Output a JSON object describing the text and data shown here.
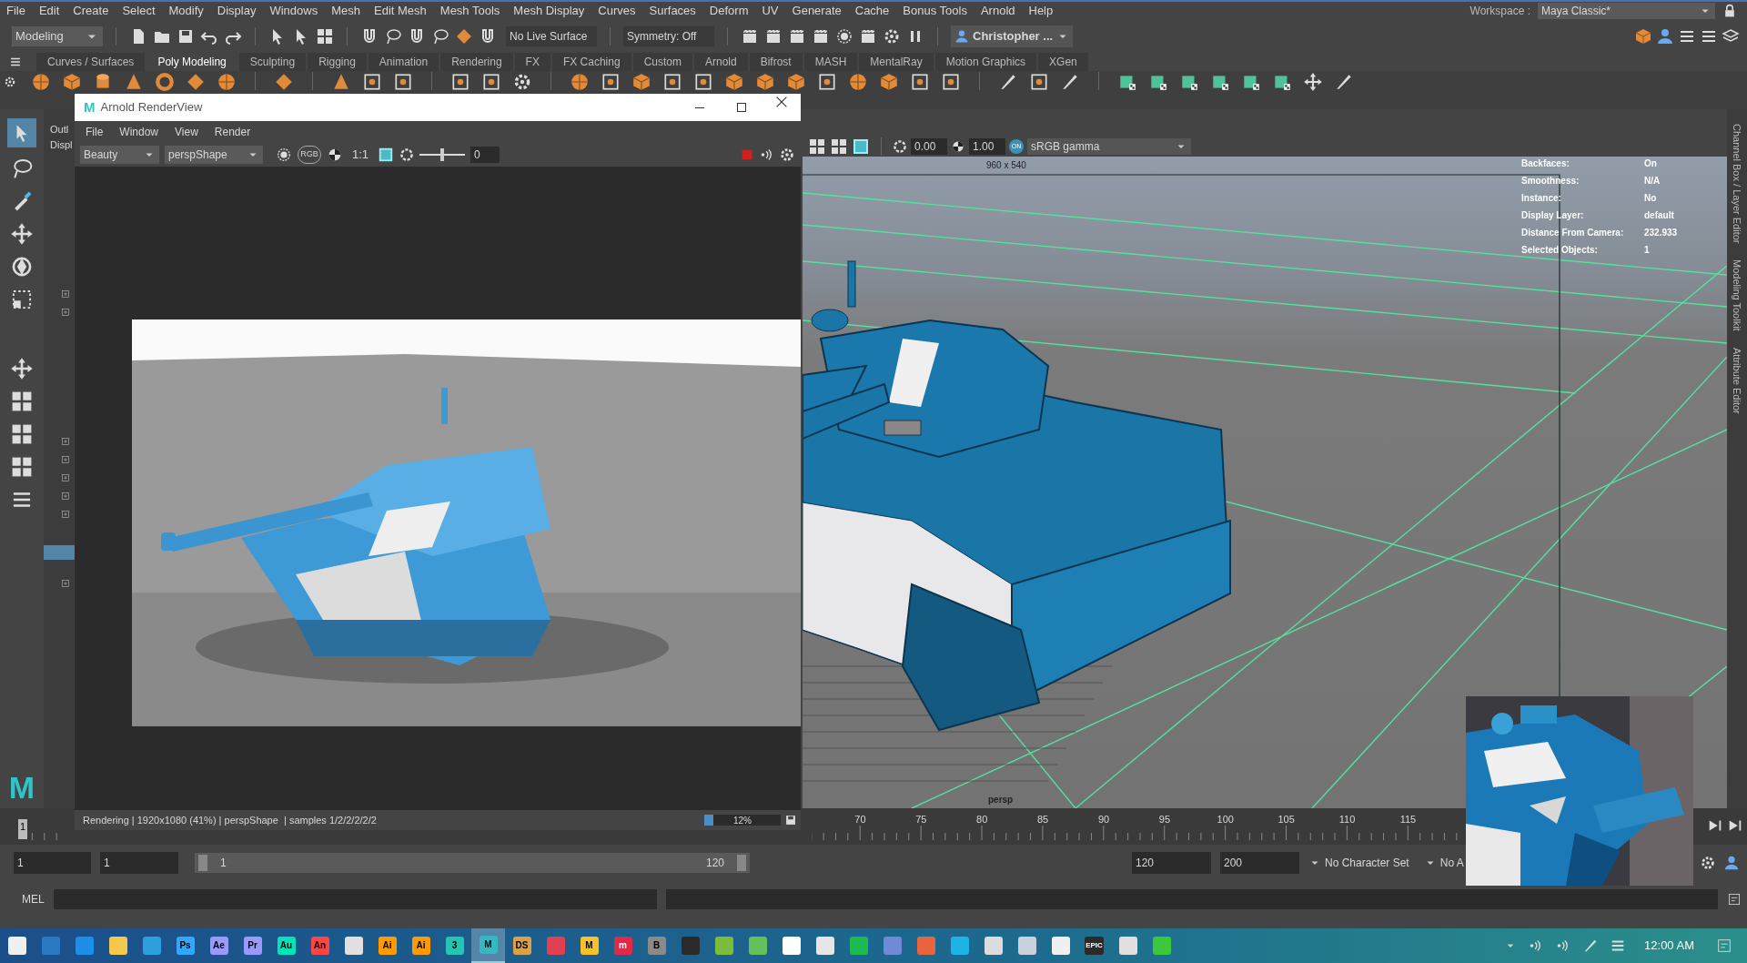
{
  "menu_bar": {
    "items": [
      "File",
      "Edit",
      "Create",
      "Select",
      "Modify",
      "Display",
      "Windows",
      "Mesh",
      "Edit Mesh",
      "Mesh Tools",
      "Mesh Display",
      "Curves",
      "Surfaces",
      "Deform",
      "UV",
      "Generate",
      "Cache",
      "Bonus Tools",
      "Arnold",
      "Help"
    ]
  },
  "status_line": {
    "mode": "Modeling",
    "live_surface": "No Live Surface",
    "symmetry": "Symmetry: Off",
    "user": "Christopher ...",
    "workspace_label": "Workspace :",
    "workspace": "Maya Classic*"
  },
  "shelf": {
    "tabs": [
      {
        "label": "Curves / Surfaces",
        "selected": false
      },
      {
        "label": "Poly Modeling",
        "selected": true
      },
      {
        "label": "Sculpting",
        "selected": false
      },
      {
        "label": "Rigging",
        "selected": false
      },
      {
        "label": "Animation",
        "selected": false
      },
      {
        "label": "Rendering",
        "selected": false
      },
      {
        "label": "FX",
        "selected": false
      },
      {
        "label": "FX Caching",
        "selected": false
      },
      {
        "label": "Custom",
        "selected": false
      },
      {
        "label": "Arnold",
        "selected": false
      },
      {
        "label": "Bifrost",
        "selected": false
      },
      {
        "label": "MASH",
        "selected": false
      },
      {
        "label": "MentalRay",
        "selected": false
      },
      {
        "label": "Motion Graphics",
        "selected": false
      },
      {
        "label": "XGen",
        "selected": false
      }
    ]
  },
  "outliner": {
    "title": "Outl",
    "display_menu": "Displ"
  },
  "logo": "M",
  "render_view": {
    "title": "Arnold RenderView",
    "logo": "M",
    "menu": [
      "File",
      "Window",
      "View",
      "Render"
    ],
    "aov": "Beauty",
    "camera": "perspShape",
    "rgb": "RGB",
    "ratio": "1:1",
    "exposure": {
      "level": 0.5,
      "value": "0"
    },
    "status": "Rendering | 1920x1080 (41%) | perspShape  | samples 1/2/2/2/2/2",
    "progress": {
      "level": 0.12,
      "label": "12%"
    }
  },
  "viewport": {
    "exposure": "0.00",
    "gamma": "1.00",
    "view_transform_toggle": "ON",
    "color_space": "sRGB gamma",
    "resolution": "960 x 540",
    "camera": "persp",
    "hud": [
      {
        "label": "Backfaces:",
        "value": "On"
      },
      {
        "label": "Smoothness:",
        "value": "N/A"
      },
      {
        "label": "Instance:",
        "value": "No"
      },
      {
        "label": "Display Layer:",
        "value": "default"
      },
      {
        "label": "Distance From Camera:",
        "value": "232.933"
      },
      {
        "label": "Selected Objects:",
        "value": "1"
      }
    ]
  },
  "side_tabs": [
    "Channel Box / Layer Editor",
    "Modeling Toolkit",
    "Attribute Editor"
  ],
  "timeline": {
    "current_frame": "1",
    "labels": [
      "70",
      "75",
      "80",
      "85",
      "90",
      "95",
      "100",
      "105",
      "110",
      "115"
    ]
  },
  "range": {
    "start": "1",
    "playback_start": "1",
    "slider": {
      "start": "1",
      "end": "120",
      "level": 1
    },
    "playback_end": "120",
    "end": "200",
    "character_set": "No Character Set",
    "anim_layer": "No A"
  },
  "command_line": {
    "language": "MEL"
  },
  "webcam": {
    "kind": "picture"
  },
  "taskbar": {
    "apps": [
      {
        "color": "#f0f0f0",
        "selected": false
      },
      {
        "color": "#2b79c2",
        "selected": false
      },
      {
        "color": "#1d8ee8",
        "selected": false
      },
      {
        "color": "#f3c84b",
        "selected": false
      },
      {
        "color": "#2ba0dc",
        "selected": false
      },
      {
        "label": "Ps",
        "color": "#31a8ff",
        "selected": false
      },
      {
        "label": "Ae",
        "color": "#9999ff",
        "selected": false
      },
      {
        "label": "Pr",
        "color": "#9999ff",
        "selected": false
      },
      {
        "label": "Au",
        "color": "#00e4bb",
        "selected": false
      },
      {
        "label": "An",
        "color": "#ff4646",
        "selected": false
      },
      {
        "color": "#e0e0e0",
        "selected": false
      },
      {
        "label": "Ai",
        "color": "#ff9a00",
        "selected": false
      },
      {
        "label": "Ai",
        "color": "#ff9a00",
        "selected": false
      },
      {
        "label": "3",
        "color": "#24c4b4",
        "selected": false
      },
      {
        "label": "M",
        "color": "#37b7c2",
        "selected": true
      },
      {
        "label": "DS",
        "color": "#d9a24a",
        "selected": false
      },
      {
        "color": "#e04050",
        "selected": false
      },
      {
        "label": "M",
        "color": "#f6c12b",
        "selected": false
      },
      {
        "label": "m",
        "color": "#e0284a",
        "selected": false
      },
      {
        "label": "B",
        "color": "#8a8a8a",
        "selected": false
      },
      {
        "color": "#2a2a2a",
        "selected": false
      },
      {
        "color": "#7bbd3a",
        "selected": false
      },
      {
        "color": "#62c25a",
        "selected": false
      },
      {
        "color": "#ffffff",
        "selected": false
      },
      {
        "color": "#e6e6e6",
        "selected": false
      },
      {
        "color": "#1db954",
        "selected": false
      },
      {
        "color": "#7289da",
        "selected": false
      },
      {
        "color": "#e8643c",
        "selected": false
      },
      {
        "color": "#1fb2e6",
        "selected": false
      },
      {
        "color": "#dcdcdc",
        "selected": false
      },
      {
        "color": "#c8d2dc",
        "selected": false
      },
      {
        "color": "#f0f0f0",
        "selected": false
      },
      {
        "label": "EPIC",
        "color": "#2a2a2a",
        "selected": false
      },
      {
        "color": "#e0e0e0",
        "selected": false
      },
      {
        "color": "#3cc83c",
        "selected": false
      }
    ],
    "clock": "12:00 AM"
  }
}
